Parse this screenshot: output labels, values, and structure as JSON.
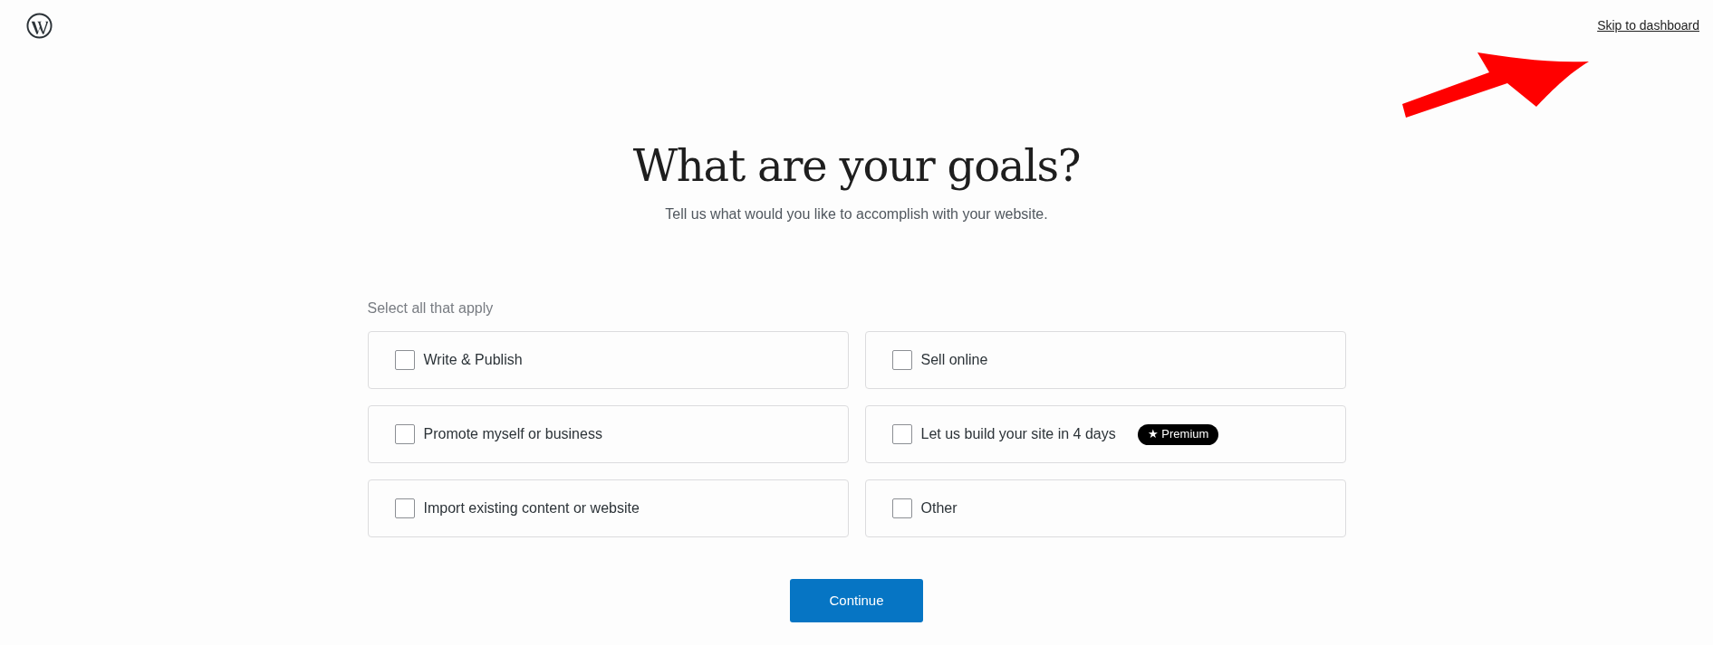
{
  "header": {
    "skip_link": "Skip to dashboard"
  },
  "title": "What are your goals?",
  "subtitle": "Tell us what would you like to accomplish with your website.",
  "hint": "Select all that apply",
  "options": [
    {
      "label": "Write & Publish",
      "checked": false
    },
    {
      "label": "Sell online",
      "checked": false
    },
    {
      "label": "Promote myself or business",
      "checked": false
    },
    {
      "label": "Let us build your site in 4 days",
      "checked": false,
      "badge": "★ Premium"
    },
    {
      "label": "Import existing content or website",
      "checked": false
    },
    {
      "label": "Other",
      "checked": false
    }
  ],
  "continue_button": "Continue"
}
